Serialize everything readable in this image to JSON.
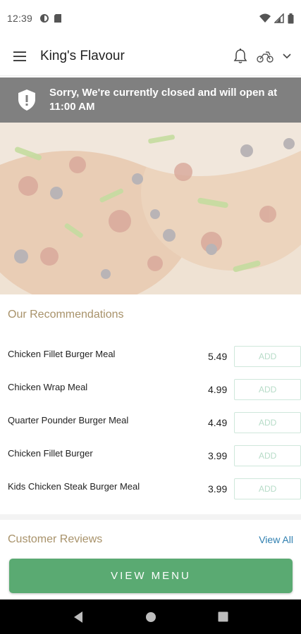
{
  "status": {
    "time": "12:39",
    "left_icons": [
      "data-saver-icon",
      "sd-card-icon"
    ],
    "right_icons": [
      "wifi-icon",
      "signal-icon",
      "battery-icon"
    ]
  },
  "app_bar": {
    "title": "King's Flavour",
    "icons": [
      "menu-icon",
      "bell-icon",
      "scooter-icon",
      "chevron-down-icon"
    ]
  },
  "banner": {
    "text": "Sorry, We're currently closed and will open at 11:00 AM",
    "icon": "shield-alert-icon"
  },
  "recommendations": {
    "title": "Our Recommendations",
    "items": [
      {
        "name": "Chicken Fillet Burger Meal",
        "price": "5.49",
        "action": "ADD"
      },
      {
        "name": "Chicken Wrap Meal",
        "price": "4.99",
        "action": "ADD"
      },
      {
        "name": "Quarter Pounder Burger Meal",
        "price": "4.49",
        "action": "ADD"
      },
      {
        "name": "Chicken Fillet Burger",
        "price": "3.99",
        "action": "ADD"
      },
      {
        "name": "Kids Chicken Steak Burger Meal",
        "price": "3.99",
        "action": "ADD"
      }
    ]
  },
  "reviews": {
    "title": "Customer Reviews",
    "view_all": "View All"
  },
  "cta": {
    "label": "VIEW MENU"
  },
  "colors": {
    "banner_bg": "#808080",
    "section_title": "#a8926a",
    "primary_button": "#5aaa72",
    "link": "#2f7fb0"
  }
}
